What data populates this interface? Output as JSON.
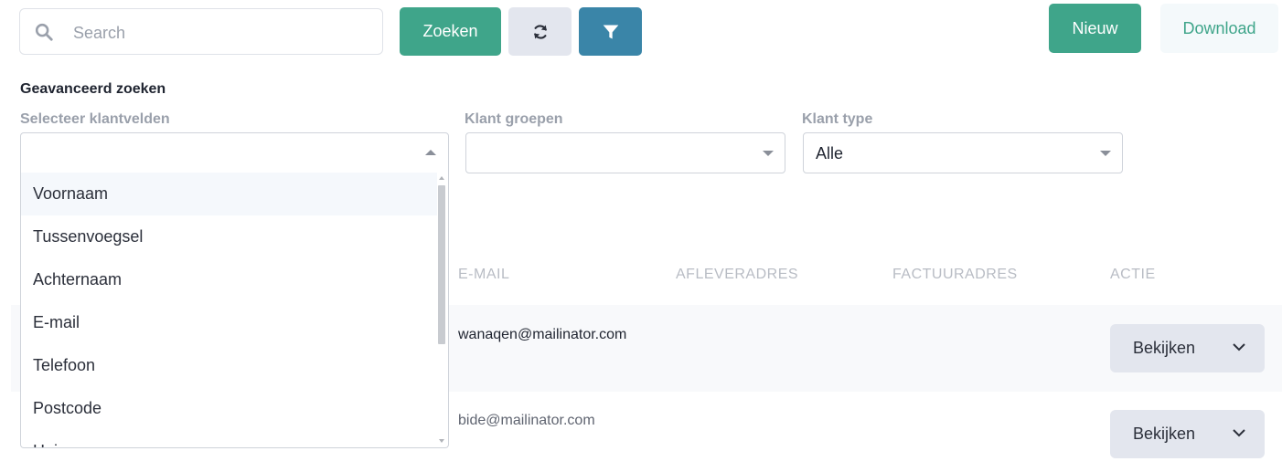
{
  "toolbar": {
    "search_placeholder": "Search",
    "search_button": "Zoeken",
    "new_button": "Nieuw",
    "download_button": "Download"
  },
  "advanced": {
    "title": "Geavanceerd zoeken",
    "fields_label": "Selecteer klantvelden",
    "fields_value": "",
    "groups_label": "Klant groepen",
    "groups_value": "",
    "type_label": "Klant type",
    "type_value": "Alle"
  },
  "dropdown_options": [
    "Voornaam",
    "Tussenvoegsel",
    "Achternaam",
    "E-mail",
    "Telefoon",
    "Postcode",
    "Huis"
  ],
  "table": {
    "headers": [
      "E-MAIL",
      "AFLEVERADRES",
      "FACTUURADRES",
      "ACTIE"
    ],
    "rows": [
      {
        "email": "wanaqen@mailinator.com",
        "action": "Bekijken"
      },
      {
        "email": "bide@mailinator.com",
        "action": "Bekijken"
      }
    ]
  },
  "colors": {
    "primary_green": "#3fa58a",
    "filter_blue": "#3a85a8",
    "muted_text": "#9aa0ab",
    "button_gray": "#e3e6ee"
  },
  "icons": {
    "search": "search-icon",
    "refresh": "refresh-icon",
    "filter": "filter-icon",
    "chevron": "chevron-down-icon"
  }
}
